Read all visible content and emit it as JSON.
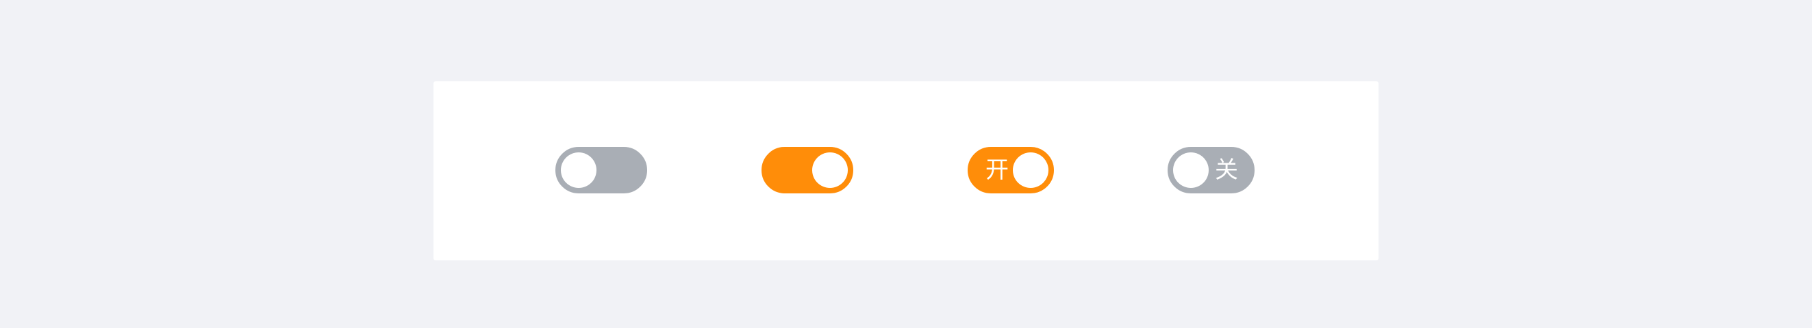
{
  "colors": {
    "page_background": "#f1f2f6",
    "card_background": "#ffffff",
    "switch_off": "#a9aeb5",
    "switch_on": "#ff8d09",
    "knob": "#ffffff"
  },
  "switches": [
    {
      "id": "basic-off",
      "checked": false,
      "text": ""
    },
    {
      "id": "basic-on",
      "checked": true,
      "text": ""
    },
    {
      "id": "text-on",
      "checked": true,
      "text": "开"
    },
    {
      "id": "text-off",
      "checked": false,
      "text": "关"
    }
  ]
}
